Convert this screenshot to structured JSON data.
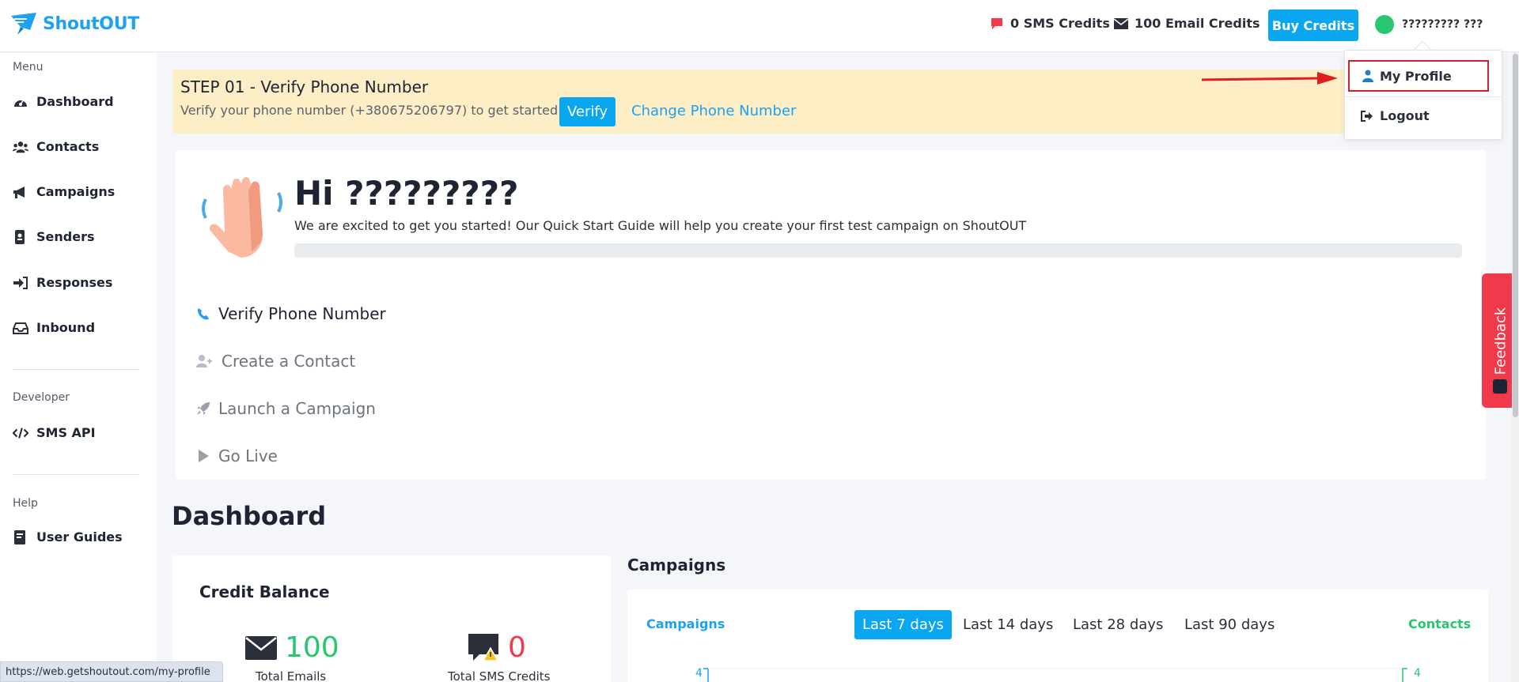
{
  "header": {
    "brand": "ShoutOUT",
    "sms_credits": "0 SMS Credits",
    "email_credits": "100 Email Credits",
    "buy_label": "Buy Credits",
    "user_name": "????????? ???"
  },
  "dropdown": {
    "profile": "My Profile",
    "logout": "Logout"
  },
  "sidebar": {
    "menu_head": "Menu",
    "items": [
      "Dashboard",
      "Contacts",
      "Campaigns",
      "Senders",
      "Responses",
      "Inbound"
    ],
    "developer_head": "Developer",
    "sms_api": "SMS API",
    "help_head": "Help",
    "user_guides": "User Guides"
  },
  "step": {
    "title": "STEP 01 - Verify Phone Number",
    "text": "Verify your phone number (+380675206797) to get started.",
    "verify_label": "Verify",
    "change_label": "Change Phone Number"
  },
  "welcome": {
    "greeting": "Hi ?????????",
    "intro": "We are excited to get you started! Our Quick Start Guide will help you create your first test campaign on ShoutOUT",
    "progress": 0,
    "guides": [
      "Verify Phone Number",
      "Create a Contact",
      "Launch a Campaign",
      "Go Live"
    ]
  },
  "dashboard": {
    "title": "Dashboard",
    "credit_title": "Credit Balance",
    "total_emails_value": "100",
    "total_emails_label": "Total Emails",
    "total_sms_value": "0",
    "total_sms_label": "Total SMS Credits",
    "campaigns_title": "Campaigns",
    "legend_campaigns": "Campaigns",
    "legend_contacts": "Contacts",
    "ranges": [
      "Last 7 days",
      "Last 14 days",
      "Last 28 days",
      "Last 90 days"
    ],
    "axis_left": "4",
    "axis_right": "4"
  },
  "feedback_label": "Feedback",
  "url_tip": "https://web.getshoutout.com/my-profile",
  "colors": {
    "accent": "#0aa6f0",
    "banner": "#fdeec6",
    "success": "#28c76f",
    "danger": "#f2384b"
  }
}
